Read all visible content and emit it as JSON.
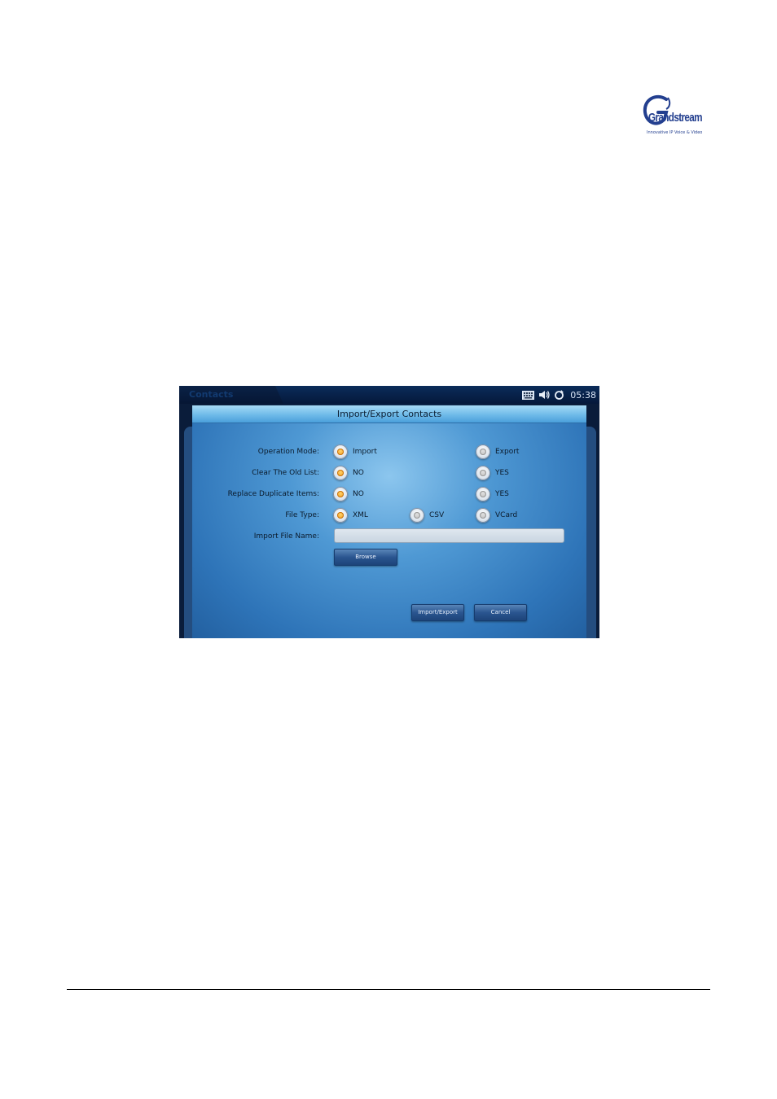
{
  "logo": {
    "wordmark": "Grandstream",
    "tagline": "Innovative IP Voice & Video"
  },
  "app": {
    "title": "Contacts",
    "clock": "05:38"
  },
  "status_icons": [
    "keyboard-icon",
    "speaker-icon",
    "sync-icon"
  ],
  "dialog": {
    "title": "Import/Export Contacts",
    "rows": [
      {
        "label": "Operation Mode:",
        "options": [
          {
            "label": "Import",
            "checked": true
          },
          {
            "label": "Export",
            "checked": false
          }
        ]
      },
      {
        "label": "Clear The Old List:",
        "options": [
          {
            "label": "NO",
            "checked": true
          },
          {
            "label": "YES",
            "checked": false
          }
        ]
      },
      {
        "label": "Replace Duplicate Items:",
        "options": [
          {
            "label": "NO",
            "checked": true
          },
          {
            "label": "YES",
            "checked": false
          }
        ]
      },
      {
        "label": "File Type:",
        "options": [
          {
            "label": "XML",
            "checked": true
          },
          {
            "label": "CSV",
            "checked": false
          },
          {
            "label": "VCard",
            "checked": false
          }
        ]
      }
    ],
    "file_name_label": "Import File Name:",
    "file_name_value": "",
    "browse_label": "Browse",
    "import_export_label": "Import/Export",
    "cancel_label": "Cancel"
  },
  "colors": {
    "accent_checked": "#f29a1c",
    "dialog_blue": "#4f99d4",
    "brand_blue": "#233f8f"
  }
}
